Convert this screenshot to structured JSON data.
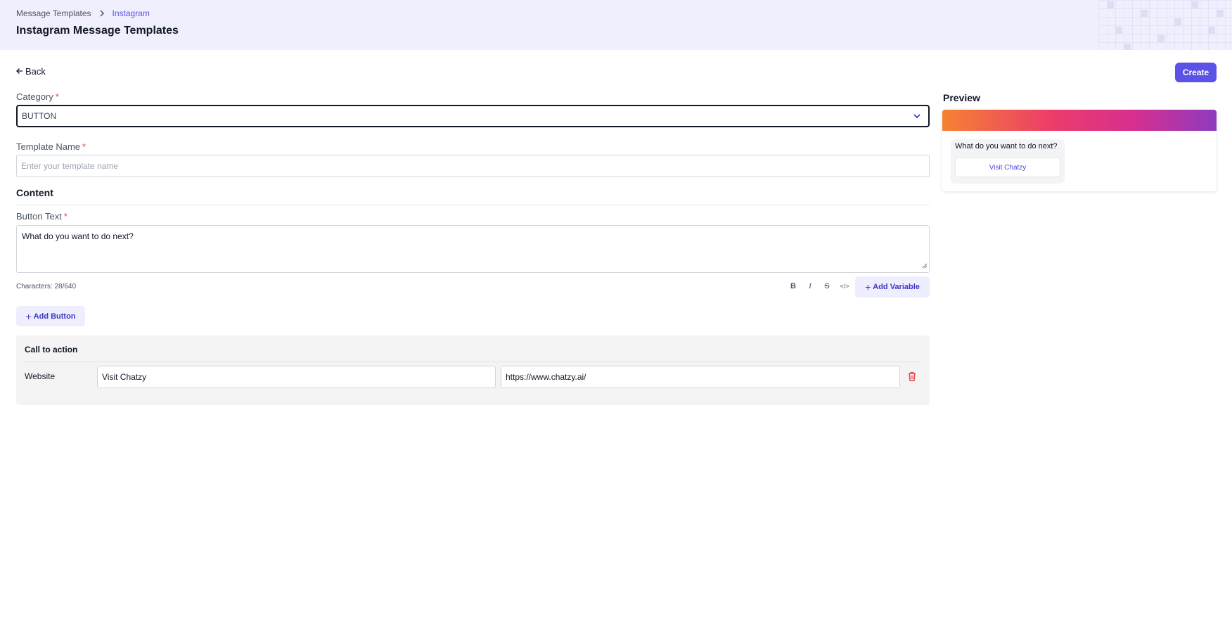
{
  "breadcrumb": {
    "parent": "Message Templates",
    "current": "Instagram"
  },
  "header": {
    "title": "Instagram Message Templates"
  },
  "actions": {
    "back_label": "Back",
    "create_label": "Create"
  },
  "form": {
    "category": {
      "label": "Category",
      "required_mark": "*",
      "value": "BUTTON"
    },
    "template_name": {
      "label": "Template Name",
      "required_mark": "*",
      "placeholder": "Enter your template name",
      "value": ""
    },
    "content_heading": "Content",
    "button_text": {
      "label": "Button Text",
      "required_mark": "*",
      "value": "What do you want to do next?"
    },
    "char_count": "Characters: 28/640",
    "toolbar": {
      "bold": "B",
      "italic": "I",
      "strike": "S",
      "code": "</>",
      "add_variable_label": "Add Variable"
    },
    "add_button_label": "Add Button"
  },
  "cta": {
    "title": "Call to action",
    "type_label": "Website",
    "button_text_value": "Visit Chatzy",
    "url_value": "https://www.chatzy.ai/"
  },
  "preview": {
    "title": "Preview",
    "message": "What do you want to do next?",
    "button_label": "Visit Chatzy"
  },
  "colors": {
    "accent": "#5b52e6",
    "header_bg": "#efeffd",
    "danger": "#ef4444"
  },
  "icons": {
    "breadcrumb_separator": "chevron-right-icon",
    "back": "arrow-left-icon",
    "select_toggle": "chevron-down-icon",
    "delete": "trash-icon"
  }
}
